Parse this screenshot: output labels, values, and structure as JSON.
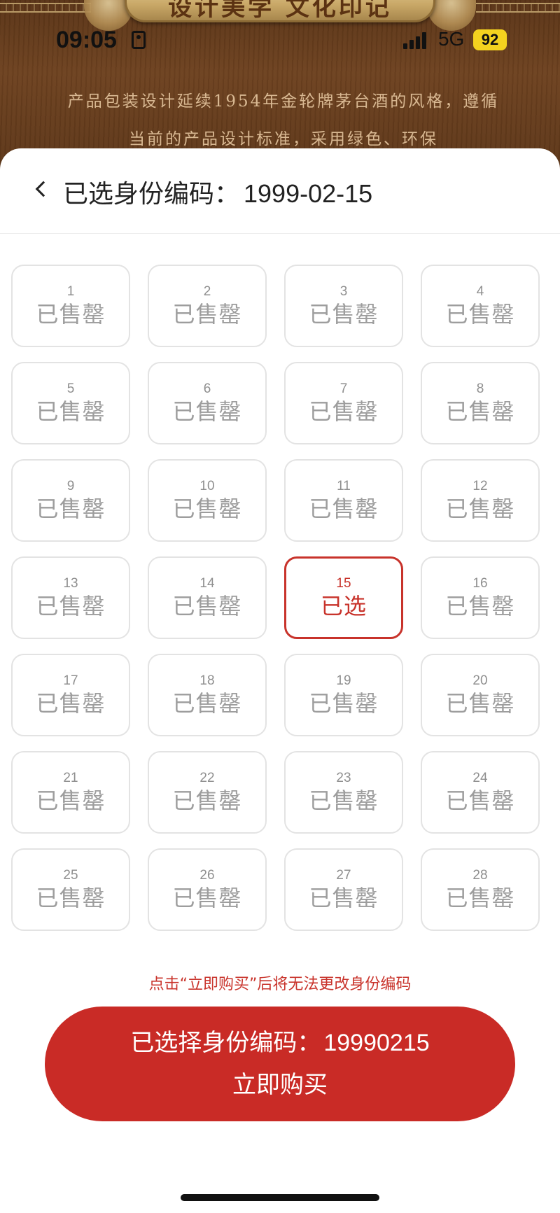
{
  "colors": {
    "accent": "#c92b26",
    "wood": "#6e4220",
    "battery": "#f4d21f"
  },
  "status_bar": {
    "time": "09:05",
    "network": "5G",
    "battery": "92"
  },
  "background": {
    "banner_title": "设计美学  文化印记",
    "intro_text": "产品包装设计延续1954年金轮牌茅台酒的风格，遵循当前的产品设计标准，采用绿色、环保"
  },
  "sheet": {
    "title_prefix": "已选身份编码：",
    "selected_code": "1999-02-15"
  },
  "grid": {
    "sold_label": "已售罄",
    "selected_label": "已选",
    "cells": [
      {
        "num": "1",
        "state": "sold",
        "label": "已售罄"
      },
      {
        "num": "2",
        "state": "sold",
        "label": "已售罄"
      },
      {
        "num": "3",
        "state": "sold",
        "label": "已售罄"
      },
      {
        "num": "4",
        "state": "sold",
        "label": "已售罄"
      },
      {
        "num": "5",
        "state": "sold",
        "label": "已售罄"
      },
      {
        "num": "6",
        "state": "sold",
        "label": "已售罄"
      },
      {
        "num": "7",
        "state": "sold",
        "label": "已售罄"
      },
      {
        "num": "8",
        "state": "sold",
        "label": "已售罄"
      },
      {
        "num": "9",
        "state": "sold",
        "label": "已售罄"
      },
      {
        "num": "10",
        "state": "sold",
        "label": "已售罄"
      },
      {
        "num": "11",
        "state": "sold",
        "label": "已售罄"
      },
      {
        "num": "12",
        "state": "sold",
        "label": "已售罄"
      },
      {
        "num": "13",
        "state": "sold",
        "label": "已售罄"
      },
      {
        "num": "14",
        "state": "sold",
        "label": "已售罄"
      },
      {
        "num": "15",
        "state": "selected",
        "label": "已选"
      },
      {
        "num": "16",
        "state": "sold",
        "label": "已售罄"
      },
      {
        "num": "17",
        "state": "sold",
        "label": "已售罄"
      },
      {
        "num": "18",
        "state": "sold",
        "label": "已售罄"
      },
      {
        "num": "19",
        "state": "sold",
        "label": "已售罄"
      },
      {
        "num": "20",
        "state": "sold",
        "label": "已售罄"
      },
      {
        "num": "21",
        "state": "sold",
        "label": "已售罄"
      },
      {
        "num": "22",
        "state": "sold",
        "label": "已售罄"
      },
      {
        "num": "23",
        "state": "sold",
        "label": "已售罄"
      },
      {
        "num": "24",
        "state": "sold",
        "label": "已售罄"
      },
      {
        "num": "25",
        "state": "sold",
        "label": "已售罄"
      },
      {
        "num": "26",
        "state": "sold",
        "label": "已售罄"
      },
      {
        "num": "27",
        "state": "sold",
        "label": "已售罄"
      },
      {
        "num": "28",
        "state": "sold",
        "label": "已售罄"
      }
    ]
  },
  "notice": "点击“立即购买”后将无法更改身份编码",
  "buy_button": {
    "line1_prefix": "已选择身份编码：",
    "line1_code": "19990215",
    "line2": "立即购买"
  },
  "icons": {
    "back": "chevron-left-icon",
    "signal": "signal-icon",
    "person": "person-badge-icon"
  }
}
